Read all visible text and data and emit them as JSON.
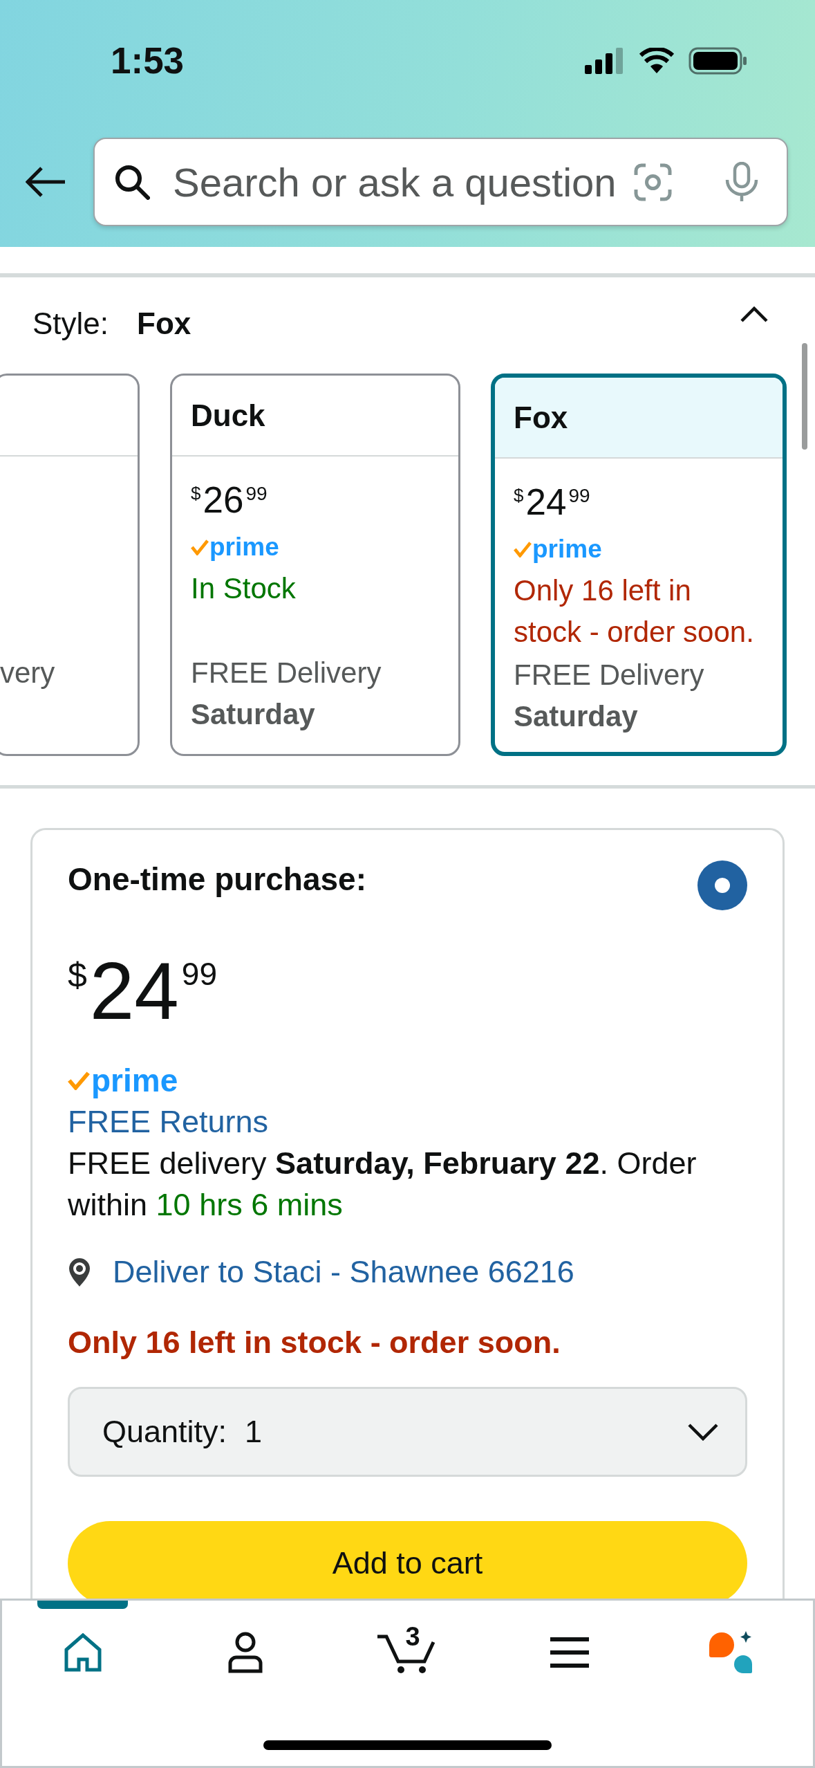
{
  "status_bar": {
    "time": "1:53"
  },
  "search": {
    "placeholder": "Search or ask a question"
  },
  "style_selector": {
    "label": "Style:",
    "value": "Fox",
    "expanded": true,
    "options": [
      {
        "partial": true,
        "selected": false,
        "delivery": "very"
      },
      {
        "partial": false,
        "selected": false,
        "title": "Duck",
        "price": {
          "symbol": "$",
          "whole": "26",
          "fraction": "99"
        },
        "prime": "prime",
        "stock": "In Stock",
        "low_stock": false,
        "delivery": "FREE Delivery",
        "delivery_day": "Saturday"
      },
      {
        "partial": false,
        "selected": true,
        "title": "Fox",
        "price": {
          "symbol": "$",
          "whole": "24",
          "fraction": "99"
        },
        "prime": "prime",
        "stock": "Only 16 left in stock - order soon.",
        "low_stock": true,
        "delivery": "FREE Delivery",
        "delivery_day": "Saturday"
      }
    ]
  },
  "purchase_option": {
    "title": "One-time purchase:",
    "selected": true,
    "price": {
      "symbol": "$",
      "whole": "24",
      "fraction": "99"
    },
    "prime": "prime",
    "returns": "FREE Returns",
    "delivery": "FREE delivery **Saturday, February 22**. Order within",
    "countdown": "10 hrs 6 mins",
    "address": "Deliver to Staci - Shawnee 66216",
    "stock": "Only 16 left in stock - order soon.",
    "quantity": {
      "label": "Quantity:",
      "value": "1"
    },
    "add_to_cart": "Add to cart"
  },
  "bottom_nav": [
    {
      "kind": "home",
      "selected": true
    },
    {
      "kind": "account",
      "selected": false
    },
    {
      "kind": "cart",
      "selected": false,
      "count": "3"
    },
    {
      "kind": "menu",
      "selected": false
    },
    {
      "kind": "assistant",
      "selected": false
    }
  ]
}
